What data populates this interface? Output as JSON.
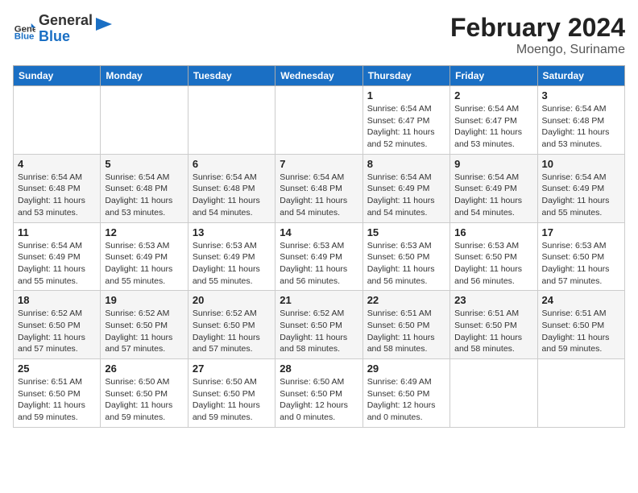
{
  "header": {
    "logo_general": "General",
    "logo_blue": "Blue",
    "title": "February 2024",
    "subtitle": "Moengo, Suriname"
  },
  "weekdays": [
    "Sunday",
    "Monday",
    "Tuesday",
    "Wednesday",
    "Thursday",
    "Friday",
    "Saturday"
  ],
  "weeks": [
    [
      {
        "day": "",
        "info": ""
      },
      {
        "day": "",
        "info": ""
      },
      {
        "day": "",
        "info": ""
      },
      {
        "day": "",
        "info": ""
      },
      {
        "day": "1",
        "info": "Sunrise: 6:54 AM\nSunset: 6:47 PM\nDaylight: 11 hours\nand 52 minutes."
      },
      {
        "day": "2",
        "info": "Sunrise: 6:54 AM\nSunset: 6:47 PM\nDaylight: 11 hours\nand 53 minutes."
      },
      {
        "day": "3",
        "info": "Sunrise: 6:54 AM\nSunset: 6:48 PM\nDaylight: 11 hours\nand 53 minutes."
      }
    ],
    [
      {
        "day": "4",
        "info": "Sunrise: 6:54 AM\nSunset: 6:48 PM\nDaylight: 11 hours\nand 53 minutes."
      },
      {
        "day": "5",
        "info": "Sunrise: 6:54 AM\nSunset: 6:48 PM\nDaylight: 11 hours\nand 53 minutes."
      },
      {
        "day": "6",
        "info": "Sunrise: 6:54 AM\nSunset: 6:48 PM\nDaylight: 11 hours\nand 54 minutes."
      },
      {
        "day": "7",
        "info": "Sunrise: 6:54 AM\nSunset: 6:48 PM\nDaylight: 11 hours\nand 54 minutes."
      },
      {
        "day": "8",
        "info": "Sunrise: 6:54 AM\nSunset: 6:49 PM\nDaylight: 11 hours\nand 54 minutes."
      },
      {
        "day": "9",
        "info": "Sunrise: 6:54 AM\nSunset: 6:49 PM\nDaylight: 11 hours\nand 54 minutes."
      },
      {
        "day": "10",
        "info": "Sunrise: 6:54 AM\nSunset: 6:49 PM\nDaylight: 11 hours\nand 55 minutes."
      }
    ],
    [
      {
        "day": "11",
        "info": "Sunrise: 6:54 AM\nSunset: 6:49 PM\nDaylight: 11 hours\nand 55 minutes."
      },
      {
        "day": "12",
        "info": "Sunrise: 6:53 AM\nSunset: 6:49 PM\nDaylight: 11 hours\nand 55 minutes."
      },
      {
        "day": "13",
        "info": "Sunrise: 6:53 AM\nSunset: 6:49 PM\nDaylight: 11 hours\nand 55 minutes."
      },
      {
        "day": "14",
        "info": "Sunrise: 6:53 AM\nSunset: 6:49 PM\nDaylight: 11 hours\nand 56 minutes."
      },
      {
        "day": "15",
        "info": "Sunrise: 6:53 AM\nSunset: 6:50 PM\nDaylight: 11 hours\nand 56 minutes."
      },
      {
        "day": "16",
        "info": "Sunrise: 6:53 AM\nSunset: 6:50 PM\nDaylight: 11 hours\nand 56 minutes."
      },
      {
        "day": "17",
        "info": "Sunrise: 6:53 AM\nSunset: 6:50 PM\nDaylight: 11 hours\nand 57 minutes."
      }
    ],
    [
      {
        "day": "18",
        "info": "Sunrise: 6:52 AM\nSunset: 6:50 PM\nDaylight: 11 hours\nand 57 minutes."
      },
      {
        "day": "19",
        "info": "Sunrise: 6:52 AM\nSunset: 6:50 PM\nDaylight: 11 hours\nand 57 minutes."
      },
      {
        "day": "20",
        "info": "Sunrise: 6:52 AM\nSunset: 6:50 PM\nDaylight: 11 hours\nand 57 minutes."
      },
      {
        "day": "21",
        "info": "Sunrise: 6:52 AM\nSunset: 6:50 PM\nDaylight: 11 hours\nand 58 minutes."
      },
      {
        "day": "22",
        "info": "Sunrise: 6:51 AM\nSunset: 6:50 PM\nDaylight: 11 hours\nand 58 minutes."
      },
      {
        "day": "23",
        "info": "Sunrise: 6:51 AM\nSunset: 6:50 PM\nDaylight: 11 hours\nand 58 minutes."
      },
      {
        "day": "24",
        "info": "Sunrise: 6:51 AM\nSunset: 6:50 PM\nDaylight: 11 hours\nand 59 minutes."
      }
    ],
    [
      {
        "day": "25",
        "info": "Sunrise: 6:51 AM\nSunset: 6:50 PM\nDaylight: 11 hours\nand 59 minutes."
      },
      {
        "day": "26",
        "info": "Sunrise: 6:50 AM\nSunset: 6:50 PM\nDaylight: 11 hours\nand 59 minutes."
      },
      {
        "day": "27",
        "info": "Sunrise: 6:50 AM\nSunset: 6:50 PM\nDaylight: 11 hours\nand 59 minutes."
      },
      {
        "day": "28",
        "info": "Sunrise: 6:50 AM\nSunset: 6:50 PM\nDaylight: 12 hours\nand 0 minutes."
      },
      {
        "day": "29",
        "info": "Sunrise: 6:49 AM\nSunset: 6:50 PM\nDaylight: 12 hours\nand 0 minutes."
      },
      {
        "day": "",
        "info": ""
      },
      {
        "day": "",
        "info": ""
      }
    ]
  ]
}
